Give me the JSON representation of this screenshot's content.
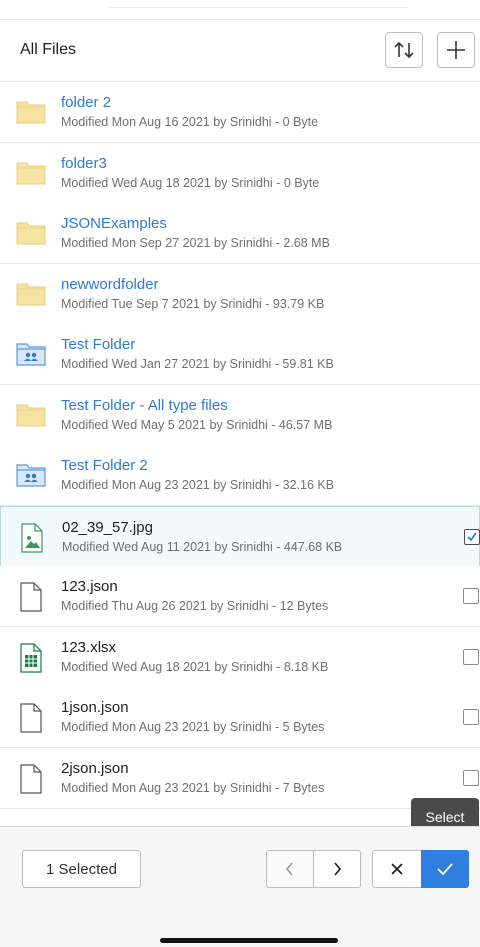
{
  "header": {
    "title": "All Files"
  },
  "items": [
    {
      "name": "folder 2",
      "meta": "Modified Mon Aug 16 2021 by Srinidhi - 0 Byte",
      "kind": "folder",
      "icon": "folder-icon"
    },
    {
      "name": "folder3",
      "meta": "Modified Wed Aug 18 2021 by Srinidhi - 0 Byte",
      "kind": "folder",
      "icon": "folder-icon"
    },
    {
      "name": "JSONExamples",
      "meta": "Modified Mon Sep 27 2021 by Srinidhi - 2.68 MB",
      "kind": "folder",
      "icon": "folder-icon"
    },
    {
      "name": "newwordfolder",
      "meta": "Modified Tue Sep 7 2021 by Srinidhi - 93.79 KB",
      "kind": "folder",
      "icon": "folder-icon"
    },
    {
      "name": "Test Folder",
      "meta": "Modified Wed Jan 27 2021 by Srinidhi - 59.81 KB",
      "kind": "folder",
      "icon": "shared-folder-icon"
    },
    {
      "name": "Test Folder - All type files",
      "meta": "Modified Wed May 5 2021 by Srinidhi - 46.57 MB",
      "kind": "folder",
      "icon": "folder-icon"
    },
    {
      "name": "Test Folder 2",
      "meta": "Modified Mon Aug 23 2021 by Srinidhi - 32.16 KB",
      "kind": "folder",
      "icon": "shared-folder-icon"
    },
    {
      "name": "02_39_57.jpg",
      "meta": "Modified Wed Aug 11 2021 by Srinidhi - 447.68 KB",
      "kind": "file",
      "icon": "image-file-icon",
      "checked": true
    },
    {
      "name": "123.json",
      "meta": "Modified Thu Aug 26 2021 by Srinidhi - 12 Bytes",
      "kind": "file",
      "icon": "document-icon",
      "checked": false
    },
    {
      "name": "123.xlsx",
      "meta": "Modified Wed Aug 18 2021 by Srinidhi - 8.18 KB",
      "kind": "file",
      "icon": "spreadsheet-icon",
      "checked": false
    },
    {
      "name": "1json.json",
      "meta": "Modified Mon Aug 23 2021 by Srinidhi - 5 Bytes",
      "kind": "file",
      "icon": "document-icon",
      "checked": false
    },
    {
      "name": "2json.json",
      "meta": "Modified Mon Aug 23 2021 by Srinidhi - 7 Bytes",
      "kind": "file",
      "icon": "document-icon",
      "checked": false
    }
  ],
  "footer": {
    "selected_label": "1 Selected",
    "tooltip": "Select"
  },
  "colors": {
    "accent": "#2f7fe0",
    "link": "#2e7bd3",
    "folder": "#f7e3a1",
    "spreadsheet": "#1f7a45"
  }
}
